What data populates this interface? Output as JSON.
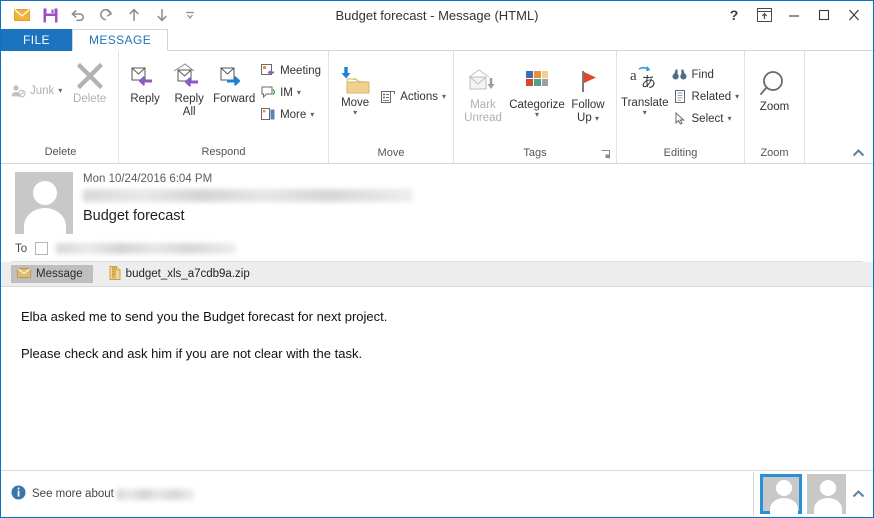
{
  "window": {
    "title": "Budget forecast - Message (HTML)",
    "accent": "#1b72c2",
    "quick_access": [
      {
        "name": "envelope-icon",
        "label": "Message"
      },
      {
        "name": "save-icon",
        "label": "Save"
      },
      {
        "name": "undo-icon",
        "label": "Undo"
      },
      {
        "name": "redo-icon",
        "label": "Redo"
      },
      {
        "name": "previous-item-icon",
        "label": "Previous Item"
      },
      {
        "name": "next-item-icon",
        "label": "Next Item"
      },
      {
        "name": "customize-qat-icon",
        "label": "Customize Quick Access Toolbar"
      }
    ],
    "controls": {
      "help": "?",
      "restore_ribbon": "Ribbon Display Options",
      "minimize": "Minimize",
      "maximize": "Maximize",
      "close": "Close"
    }
  },
  "tabs": {
    "file": "FILE",
    "message": "MESSAGE"
  },
  "ribbon": {
    "collapse_label": "Collapse the Ribbon",
    "groups": [
      {
        "label": "Delete",
        "buttons": [
          {
            "label": "Junk",
            "icon": "junk-icon",
            "disabled": true,
            "dropdown": true
          },
          {
            "label": "Delete",
            "icon": "delete-x-icon",
            "disabled": true,
            "dropdown": false
          }
        ]
      },
      {
        "label": "Respond",
        "buttons": [
          {
            "label": "Reply",
            "icon": "reply-icon"
          },
          {
            "label": "Reply All",
            "icon": "reply-all-icon"
          },
          {
            "label": "Forward",
            "icon": "forward-icon"
          },
          {
            "label": "Meeting",
            "icon": "meeting-icon"
          },
          {
            "label": "IM",
            "icon": "im-icon",
            "dropdown": true
          },
          {
            "label": "More",
            "icon": "more-icon",
            "dropdown": true
          }
        ]
      },
      {
        "label": "Move",
        "buttons": [
          {
            "label": "Move",
            "icon": "move-folder-icon",
            "dropdown": true
          },
          {
            "label": "Actions",
            "icon": "actions-icon",
            "dropdown": true
          }
        ]
      },
      {
        "label": "Tags",
        "has_dialog_launcher": true,
        "buttons": [
          {
            "label": "Mark Unread",
            "icon": "mark-unread-icon",
            "disabled": true
          },
          {
            "label": "Categorize",
            "icon": "categorize-icon",
            "dropdown": true
          },
          {
            "label": "Follow Up",
            "icon": "follow-up-flag-icon",
            "dropdown": true
          }
        ]
      },
      {
        "label": "Editing",
        "buttons": [
          {
            "label": "Translate",
            "icon": "translate-icon",
            "dropdown": true
          },
          {
            "label": "Find",
            "icon": "find-binoculars-icon"
          },
          {
            "label": "Related",
            "icon": "related-icon",
            "dropdown": true
          },
          {
            "label": "Select",
            "icon": "select-cursor-icon",
            "dropdown": true
          }
        ]
      },
      {
        "label": "Zoom",
        "buttons": [
          {
            "label": "Zoom",
            "icon": "zoom-magnifier-icon"
          }
        ]
      }
    ]
  },
  "message": {
    "date": "Mon 10/24/2016 6:04 PM",
    "sender_redacted": true,
    "subject": "Budget forecast",
    "to_label": "To",
    "to_redacted": true,
    "avatar": "contact-avatar-icon"
  },
  "attachments": {
    "message_tab_label": "Message",
    "message_tab_icon": "envelope-icon",
    "files": [
      {
        "name": "budget_xls_a7cdb9a.zip",
        "icon": "zip-file-icon"
      }
    ]
  },
  "body": {
    "paragraphs": [
      "Elba asked me to send you the Budget forecast for next project.",
      "Please check and ask him if you are not clear with the task."
    ]
  },
  "footer": {
    "see_more_prefix": "See more about",
    "see_more_redacted": true,
    "info_icon": "info-icon",
    "people_pane": {
      "cards": [
        {
          "name": "person-card-1",
          "selected": true
        },
        {
          "name": "person-card-2",
          "selected": false
        }
      ],
      "expand_icon": "chevron-up-icon"
    }
  }
}
